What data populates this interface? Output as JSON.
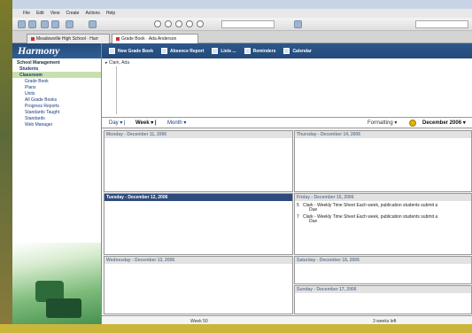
{
  "menubar": [
    "File",
    "Edit",
    "View",
    "Create",
    "Actions",
    "Help"
  ],
  "browser_tabs": [
    {
      "label": "Meadowville High School · Harr",
      "active": false
    },
    {
      "label": "Grade Book · Ada Anderson",
      "active": true
    }
  ],
  "sidebar": {
    "brand": "Harmony",
    "section": "School Management",
    "items": [
      {
        "label": "Students",
        "selected": false
      },
      {
        "label": "Classroom",
        "selected": true
      }
    ],
    "subitems": [
      "Grade Book",
      "Plans",
      "Units",
      "All Grade Books",
      "Progress Reports",
      "Standards Taught",
      "Standards",
      "Web Manager"
    ]
  },
  "app_toolbar": [
    {
      "label": "New Grade Book",
      "icon": "book-icon"
    },
    {
      "label": "Absence Report",
      "icon": "report-icon"
    },
    {
      "label": "Lists ...",
      "icon": "list-icon"
    },
    {
      "label": "Reminders",
      "icon": "reminder-icon"
    },
    {
      "label": "Calendar",
      "icon": "calendar-icon"
    }
  ],
  "student": {
    "label": "Clark, Ada"
  },
  "view": {
    "day": "Day",
    "week": "Week",
    "month": "Month",
    "formatting": "Formatting",
    "month_label": "December 2006"
  },
  "days": [
    {
      "label": "Monday - December 11, 2006",
      "selected": false,
      "events": []
    },
    {
      "label": "Tuesday - December 12, 2006",
      "selected": true,
      "events": []
    },
    {
      "label": "Wednesday - December 13, 2006",
      "selected": false,
      "events": []
    },
    {
      "label": "Thursday - December 14, 2006",
      "selected": false,
      "events": []
    },
    {
      "label": "Friday - December 15, 2006",
      "selected": false,
      "events": [
        {
          "num": "5",
          "text": "Clark - Weekly Time Sheet   Each week, publication students submit a",
          "sub": "Due"
        },
        {
          "num": "7",
          "text": "Clark - Weekly Time Sheet   Each week, publication students submit a",
          "sub": "Due"
        }
      ]
    },
    {
      "label": "Saturday - December 16, 2006",
      "selected": false,
      "events": []
    },
    {
      "label": "Sunday - December 17, 2006",
      "selected": false,
      "events": []
    }
  ],
  "status": {
    "left": "Week 50",
    "right": "3 weeks left"
  },
  "colors": {
    "brand_bar": "#264b7a",
    "selected_day": "#2f4a7c",
    "frame": "#d8c24a"
  }
}
